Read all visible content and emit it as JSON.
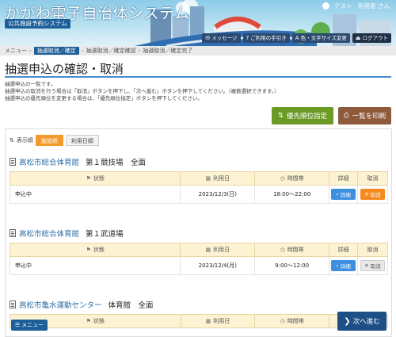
{
  "header": {
    "site_title": "かがわ電子自治体システム",
    "site_subtitle": "公共施設予約システム",
    "user_name": "テスト　利用者 さん",
    "nav": [
      {
        "icon": "message-icon",
        "label": "メッセージ"
      },
      {
        "icon": "help-icon",
        "label": "ご利用の手引き"
      },
      {
        "icon": "text-size-icon",
        "label": "色・文字サイズ変更"
      },
      {
        "icon": "logout-icon",
        "label": "ログアウト"
      }
    ]
  },
  "breadcrumb": [
    "メニュー",
    "抽選取消／確定",
    "抽選取消／確定確認",
    "抽選取消／確定完了"
  ],
  "page": {
    "title": "抽選申込の確認・取消",
    "description": [
      "抽選申込の一覧です。",
      "抽選申込の取消を行う場合は「取消」ボタンを押下し、「次へ進む」ボタンを押下してください。（複数選択できます。）",
      "抽選申込の優先順位を変更する場合は、「優先順位指定」ボタンを押下してください。"
    ]
  },
  "actions": {
    "priority_label": "優先順位指定",
    "print_label": "一覧を印刷"
  },
  "sort": {
    "label": "表示順",
    "options": [
      "施設順",
      "利用日順"
    ],
    "selected": "施設順"
  },
  "table_headers": {
    "status": "状態",
    "date": "利用日",
    "time": "時間帯",
    "detail": "詳細",
    "cancel": "取消"
  },
  "reservations": [
    {
      "facility": "高松市総合体育館",
      "room": "第１競技場　全面",
      "status": "申込中",
      "date": "2023/12/3(日)",
      "time": "18:00～22:00",
      "detail_label": "詳細",
      "cancel_label": "取消",
      "cancel_selected": true
    },
    {
      "facility": "高松市総合体育館",
      "room": "第１武道場",
      "status": "申込中",
      "date": "2023/12/4(月)",
      "time": "9:00～12:00",
      "detail_label": "詳細",
      "cancel_label": "取消",
      "cancel_selected": false
    },
    {
      "facility": "高松市亀水運動センター",
      "room": "体育館　全面",
      "status": "",
      "date": "",
      "time": "",
      "detail_label": "",
      "cancel_label": "",
      "cancel_selected": false
    }
  ],
  "footer": {
    "menu_label": "メニュー",
    "next_label": "次へ進む"
  },
  "colors": {
    "brand_blue": "#1d5f99",
    "accent_orange": "#f39a2b",
    "priority_green": "#6b9a26",
    "print_brown": "#8d5a3c",
    "detail_blue": "#3d8fe0"
  }
}
